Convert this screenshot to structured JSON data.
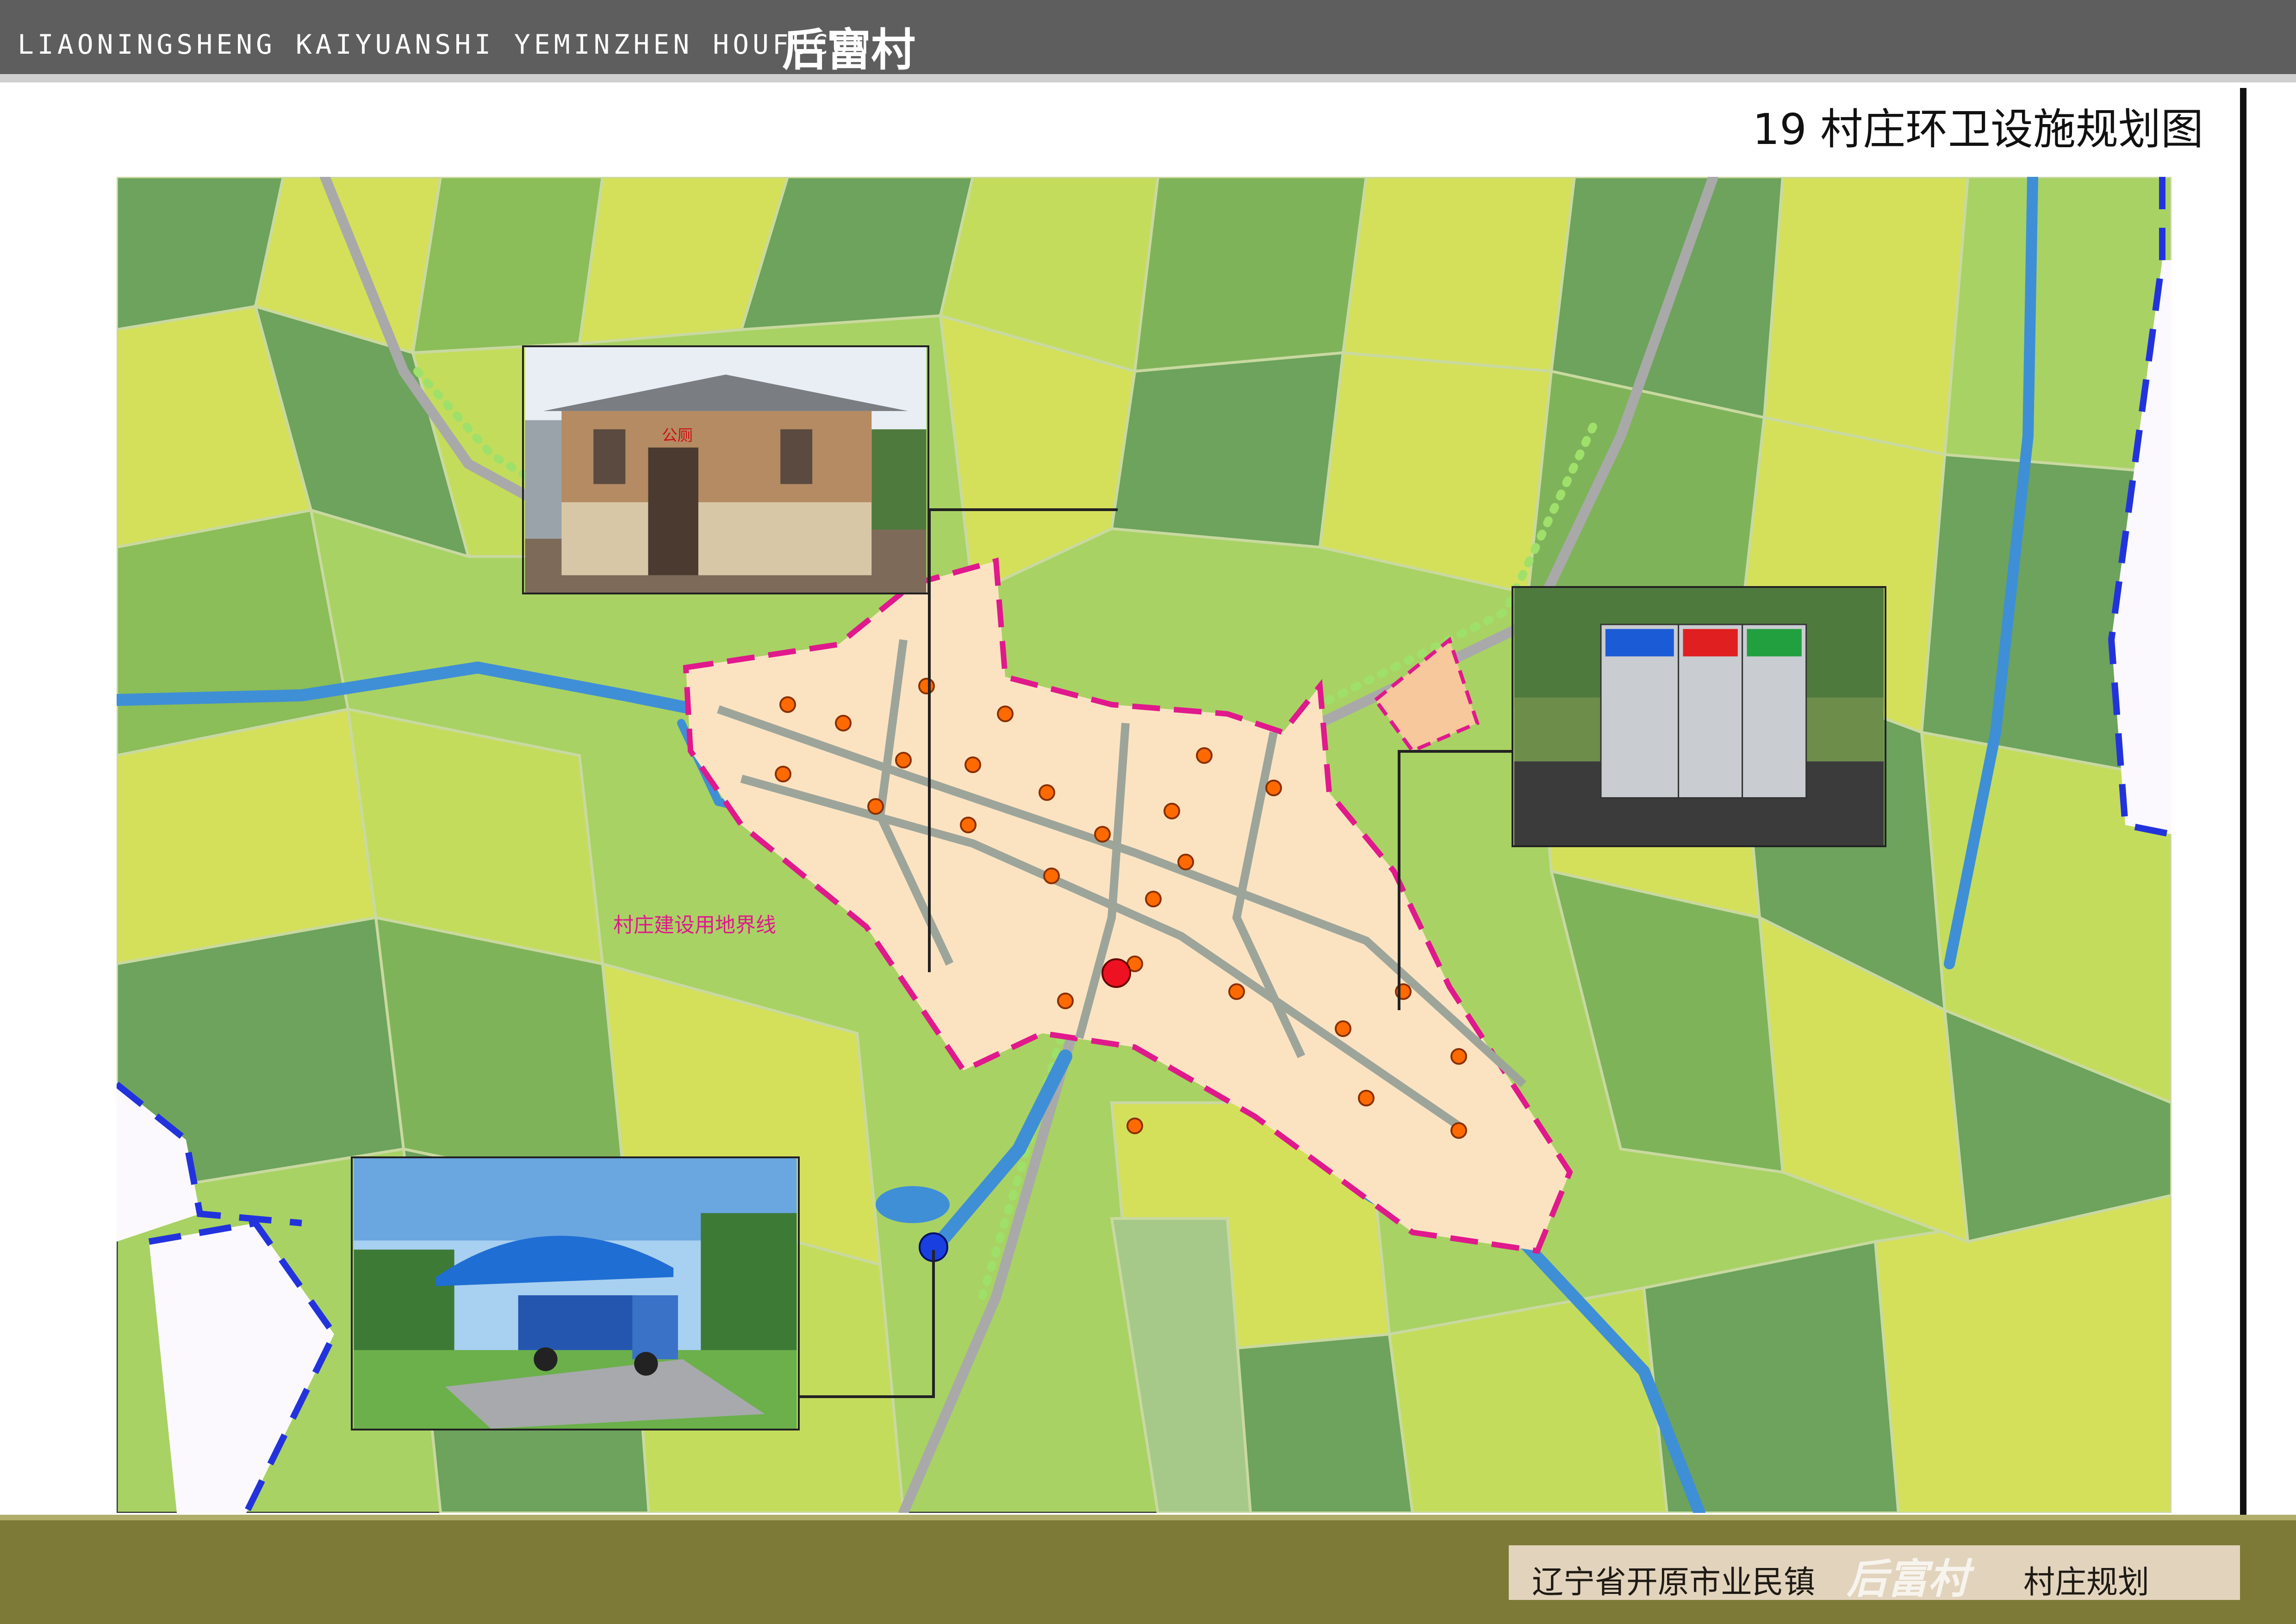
{
  "header": {
    "title_en": "LIAONINGSHENG KAIYUANSHI YEMINZHEN HOUFUCUN",
    "title_cn": "后富村",
    "sheet_title": "19 村庄环卫设施规划图"
  },
  "map": {
    "boundary_label": "村庄建设用地界线",
    "colors": {
      "field_yellow": "#d4e05a",
      "field_light": "#a8d264",
      "field_dark": "#6da35c",
      "road": "#a9a9a9",
      "river": "#3f8fd6",
      "village": "#fbe3c2",
      "boundary": "#e0198c",
      "waste_bin": "#ff6a00",
      "toilet_marker": "#ee1122",
      "transfer_marker": "#1a3fe0",
      "admin_boundary": "#2233dd"
    }
  },
  "photos": {
    "toilet_sign": "公厕"
  },
  "footer": {
    "location": "辽宁省开原市业民镇",
    "village": "后富村",
    "suffix": "村庄规划"
  }
}
